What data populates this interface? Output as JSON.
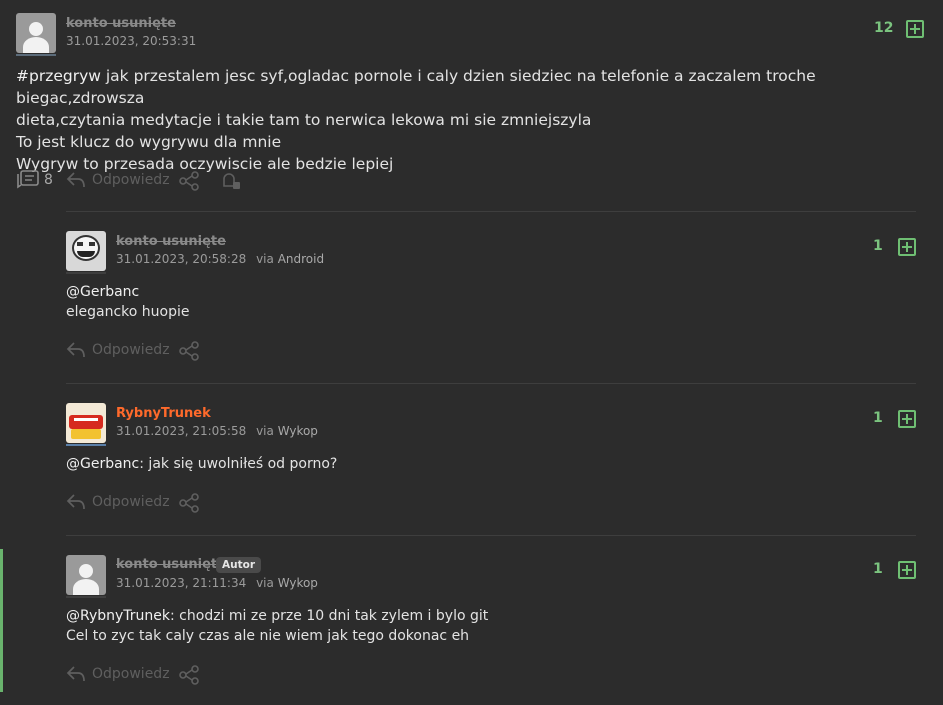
{
  "entry": {
    "username": "konto usunięte",
    "timestamp": "31.01.2023, 20:53:31",
    "votes": "12",
    "tag": "#przegryw",
    "text_line1": "jak przestalem jesc syf,ogladac pornole i caly dzien siedziec na telefonie a zaczalem troche biegac,zdrowsza",
    "text_line2": "dieta,czytania medytacje i takie tam to nerwica lekowa mi sie zmniejszyla",
    "text_line3": "To jest klucz do wygrywu dla mnie",
    "text_line4": "Wygryw to przesada oczywiscie ale bedzie lepiej",
    "comment_count": "8",
    "reply_label": "Odpowiedz"
  },
  "comments": [
    {
      "username": "konto usunięte",
      "timestamp": "31.01.2023, 20:58:28",
      "via": "via",
      "source": "Android",
      "votes": "1",
      "mention": "@Gerbanc",
      "line1": "",
      "line2": "elegancko huopie",
      "reply_label": "Odpowiedz"
    },
    {
      "username": "RybnyTrunek",
      "timestamp": "31.01.2023, 21:05:58",
      "via": "via",
      "source": "Wykop",
      "votes": "1",
      "mention": "@Gerbanc",
      "line1": ": jak się uwolniłeś od porno?",
      "reply_label": "Odpowiedz"
    },
    {
      "username": "konto usunięte",
      "badge": "Autor",
      "timestamp": "31.01.2023, 21:11:34",
      "via": "via",
      "source": "Wykop",
      "votes": "1",
      "mention": "@RybnyTrunek",
      "line1": ": chodzi mi ze prze 10 dni tak zylem i bylo git",
      "line2": "Cel to zyc tak caly czas ale nie wiem jak tego dokonac eh",
      "reply_label": "Odpowiedz"
    }
  ],
  "colors": {
    "background": "#2c2c2c",
    "vote_green": "#6fbf73",
    "active_user": "#ff6a2b",
    "author_bar": "#69b36d"
  }
}
